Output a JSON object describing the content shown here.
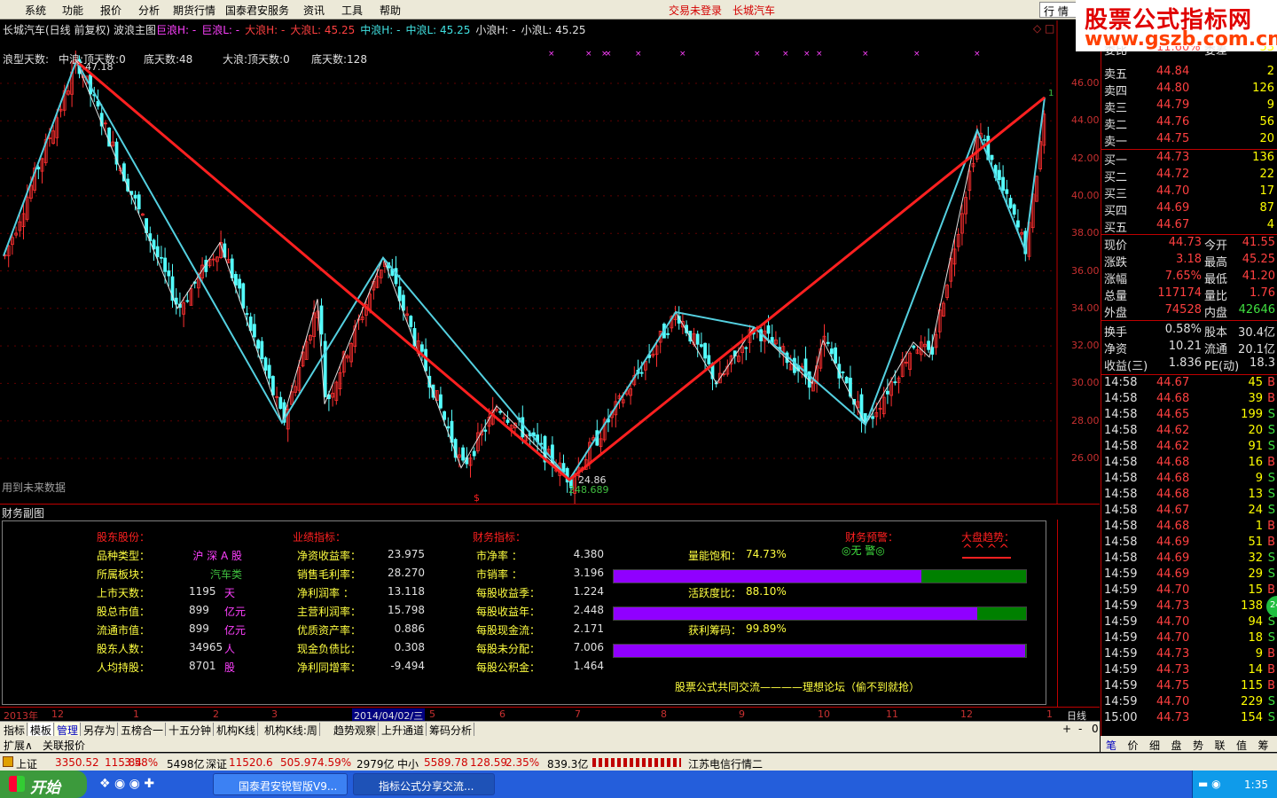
{
  "menu": {
    "items": [
      "系统",
      "功能",
      "报价",
      "分析",
      "期货行情",
      "国泰君安服务",
      "资讯",
      "工具",
      "帮助"
    ],
    "trade_status": "交易未登录",
    "stock_name": "长城汽车",
    "quote_tab": "行 情"
  },
  "watermark": {
    "line1": "股票公式指标网",
    "line2": "www.gszb.com.cn"
  },
  "chart": {
    "title": "长城汽车(日线 前复权) 波浪主图",
    "indicators": [
      "巨浪H: -",
      "巨浪L: -",
      "大浪H: -",
      "大浪L: 45.25",
      "中浪H: -",
      "中浪L: 45.25",
      "小浪H: -",
      "小浪L: 45.25"
    ],
    "indicator_colors": [
      "#ff40ff",
      "#ff40ff",
      "#ff4040",
      "#ff4040",
      "#40e0e0",
      "#40e0e0",
      "#e0e0e0",
      "#e0e0e0"
    ],
    "wave_info": [
      "浪型天数:",
      "中浪:顶天数:0",
      "底天数:48",
      "大浪:顶天数:0",
      "底天数:128"
    ],
    "high_label": "47.18",
    "low_label": "24.86",
    "low_label2": "248.689",
    "right_label": "1",
    "future_note": "用到未来数据",
    "price_axis": [
      "46.00",
      "44.00",
      "42.00",
      "40.00",
      "38.00",
      "36.00",
      "34.00",
      "32.00",
      "30.00",
      "28.00",
      "26.00"
    ],
    "dollar_mark": "$",
    "marker": "×"
  },
  "orderbook": {
    "partial_label": "委比",
    "partial_value": "11.60%",
    "partial_label2": "委差",
    "partial_value2": "53",
    "asks": [
      {
        "name": "卖五",
        "price": "44.84",
        "vol": "2"
      },
      {
        "name": "卖四",
        "price": "44.80",
        "vol": "126"
      },
      {
        "name": "卖三",
        "price": "44.79",
        "vol": "9"
      },
      {
        "name": "卖二",
        "price": "44.76",
        "vol": "56"
      },
      {
        "name": "卖一",
        "price": "44.75",
        "vol": "20"
      }
    ],
    "bids": [
      {
        "name": "买一",
        "price": "44.73",
        "vol": "136"
      },
      {
        "name": "买二",
        "price": "44.72",
        "vol": "22"
      },
      {
        "name": "买三",
        "price": "44.70",
        "vol": "17"
      },
      {
        "name": "买四",
        "price": "44.69",
        "vol": "87"
      },
      {
        "name": "买五",
        "price": "44.67",
        "vol": "4"
      }
    ]
  },
  "stats": [
    {
      "k1": "现价",
      "v1": "44.73",
      "k2": "今开",
      "v2": "41.55"
    },
    {
      "k1": "涨跌",
      "v1": "3.18",
      "k2": "最高",
      "v2": "45.25"
    },
    {
      "k1": "涨幅",
      "v1": "7.65%",
      "k2": "最低",
      "v2": "41.20"
    },
    {
      "k1": "总量",
      "v1": "117174",
      "k2": "量比",
      "v2": "1.76"
    },
    {
      "k1": "外盘",
      "v1": "74528",
      "k2": "内盘",
      "v2": "42646"
    },
    {
      "k1": "换手",
      "v1": "0.58%",
      "k2": "股本",
      "v2": "30.4亿"
    },
    {
      "k1": "净资",
      "v1": "10.21",
      "k2": "流通",
      "v2": "20.1亿"
    },
    {
      "k1": "收益(三)",
      "v1": "1.836",
      "k2": "PE(动)",
      "v2": "18.3"
    }
  ],
  "ticks": [
    {
      "t": "14:58",
      "p": "44.67",
      "v": "45",
      "s": "B"
    },
    {
      "t": "14:58",
      "p": "44.68",
      "v": "39",
      "s": "B"
    },
    {
      "t": "14:58",
      "p": "44.65",
      "v": "199",
      "s": "S"
    },
    {
      "t": "14:58",
      "p": "44.62",
      "v": "20",
      "s": "S"
    },
    {
      "t": "14:58",
      "p": "44.62",
      "v": "91",
      "s": "S"
    },
    {
      "t": "14:58",
      "p": "44.68",
      "v": "16",
      "s": "B"
    },
    {
      "t": "14:58",
      "p": "44.68",
      "v": "9",
      "s": "S"
    },
    {
      "t": "14:58",
      "p": "44.68",
      "v": "13",
      "s": "S"
    },
    {
      "t": "14:58",
      "p": "44.67",
      "v": "24",
      "s": "S"
    },
    {
      "t": "14:58",
      "p": "44.68",
      "v": "1",
      "s": "B"
    },
    {
      "t": "14:58",
      "p": "44.69",
      "v": "51",
      "s": "B"
    },
    {
      "t": "14:58",
      "p": "44.69",
      "v": "32",
      "s": "S"
    },
    {
      "t": "14:59",
      "p": "44.69",
      "v": "29",
      "s": "S"
    },
    {
      "t": "14:59",
      "p": "44.70",
      "v": "15",
      "s": "B"
    },
    {
      "t": "14:59",
      "p": "44.73",
      "v": "138",
      "s": "B"
    },
    {
      "t": "14:59",
      "p": "44.70",
      "v": "94",
      "s": "S"
    },
    {
      "t": "14:59",
      "p": "44.70",
      "v": "18",
      "s": "S"
    },
    {
      "t": "14:59",
      "p": "44.73",
      "v": "9",
      "s": "B"
    },
    {
      "t": "14:59",
      "p": "44.73",
      "v": "14",
      "s": "B"
    },
    {
      "t": "14:59",
      "p": "44.75",
      "v": "115",
      "s": "B"
    },
    {
      "t": "14:59",
      "p": "44.70",
      "v": "229",
      "s": "S"
    },
    {
      "t": "15:00",
      "p": "44.73",
      "v": "154",
      "s": "S"
    }
  ],
  "fin_panel": {
    "title": "财务副图",
    "headers": [
      "股东股份：",
      "业绩指标：",
      "财务指标：",
      "财务预警：",
      "大盘趋势："
    ],
    "col1": [
      {
        "k": "品种类型：",
        "v": "沪 深 A 股",
        "u": ""
      },
      {
        "k": "所属板块：",
        "v": "汽车类",
        "u": ""
      },
      {
        "k": "上市天数：",
        "v": "1195",
        "u": "天"
      },
      {
        "k": "股总市值：",
        "v": "899",
        "u": "亿元"
      },
      {
        "k": "流通市值：",
        "v": "899",
        "u": "亿元"
      },
      {
        "k": "股东人数：",
        "v": "34965",
        "u": "人"
      },
      {
        "k": "人均持股：",
        "v": "8701",
        "u": "股"
      }
    ],
    "col2": [
      {
        "k": "净资收益率：",
        "v": "23.975"
      },
      {
        "k": "销售毛利率：",
        "v": "28.270"
      },
      {
        "k": "净利润率 ：",
        "v": "13.118"
      },
      {
        "k": "主营利润率：",
        "v": "15.798"
      },
      {
        "k": "优质资产率：",
        "v": "0.886"
      },
      {
        "k": "现金负债比：",
        "v": "0.308"
      },
      {
        "k": "净利同增率：",
        "v": "-9.494"
      }
    ],
    "col3": [
      {
        "k": "市净率  ：",
        "v": "4.380"
      },
      {
        "k": "市销率  ：",
        "v": "3.196"
      },
      {
        "k": "每股收益季：",
        "v": "1.224"
      },
      {
        "k": "每股收益年：",
        "v": "2.448"
      },
      {
        "k": "每股现金流：",
        "v": "2.171"
      },
      {
        "k": "每股未分配：",
        "v": "7.006"
      },
      {
        "k": "每股公积金：",
        "v": "1.464"
      }
    ],
    "warning": "◎无 警◎",
    "trend_marks": "^^^^",
    "bars": [
      {
        "label": "量能饱和：",
        "value": "74.73%",
        "pct": 0.7473
      },
      {
        "label": "活跃度比：",
        "value": "88.10%",
        "pct": 0.881
      },
      {
        "label": "获利筹码：",
        "value": "99.89%",
        "pct": 0.9989
      }
    ],
    "footer": "股票公式共同交流————理想论坛（偷不到就抢）"
  },
  "date_axis": {
    "labels": [
      "2013年",
      "12",
      "1",
      "2",
      "3",
      "4",
      "5",
      "6",
      "7",
      "8",
      "9",
      "10",
      "11",
      "12",
      "1"
    ],
    "cursor_date": "2014/04/02/三",
    "period": "日线"
  },
  "tabs": [
    "指标",
    "模板",
    "管理",
    "另存为",
    "五榜合一",
    "十五分钟",
    "机构K线",
    "机构K线:周",
    "趋势观察",
    "上升通道",
    "筹码分析"
  ],
  "tab_controls": [
    "+",
    "-",
    "0"
  ],
  "expand_row": [
    "扩展∧",
    "关联报价"
  ],
  "right_tabs": [
    "笔",
    "价",
    "细",
    "盘",
    "势",
    "联",
    "值",
    "筹"
  ],
  "index_bar": [
    {
      "text": "上证",
      "color": "#000"
    },
    {
      "text": "3350.52",
      "color": "#d00000"
    },
    {
      "text": "115.84",
      "color": "#d00000"
    },
    {
      "text": "3.58%",
      "color": "#d00000"
    },
    {
      "text": "5498亿",
      "color": "#000"
    },
    {
      "text": "深证",
      "color": "#000"
    },
    {
      "text": "11520.6",
      "color": "#d00000"
    },
    {
      "text": "505.97",
      "color": "#d00000"
    },
    {
      "text": "4.59%",
      "color": "#d00000"
    },
    {
      "text": "2979亿",
      "color": "#000"
    },
    {
      "text": "中小",
      "color": "#000"
    },
    {
      "text": "5589.78",
      "color": "#d00000"
    },
    {
      "text": "128.59",
      "color": "#d00000"
    },
    {
      "text": "2.35%",
      "color": "#d00000"
    },
    {
      "text": "839.3亿",
      "color": "#000"
    },
    {
      "text": "江苏电信行情二",
      "color": "#000"
    }
  ],
  "taskbar": {
    "start": "开始",
    "windows": [
      "国泰君安锐智版V9...",
      "指标公式分享交流..."
    ],
    "clock": "1:35"
  }
}
